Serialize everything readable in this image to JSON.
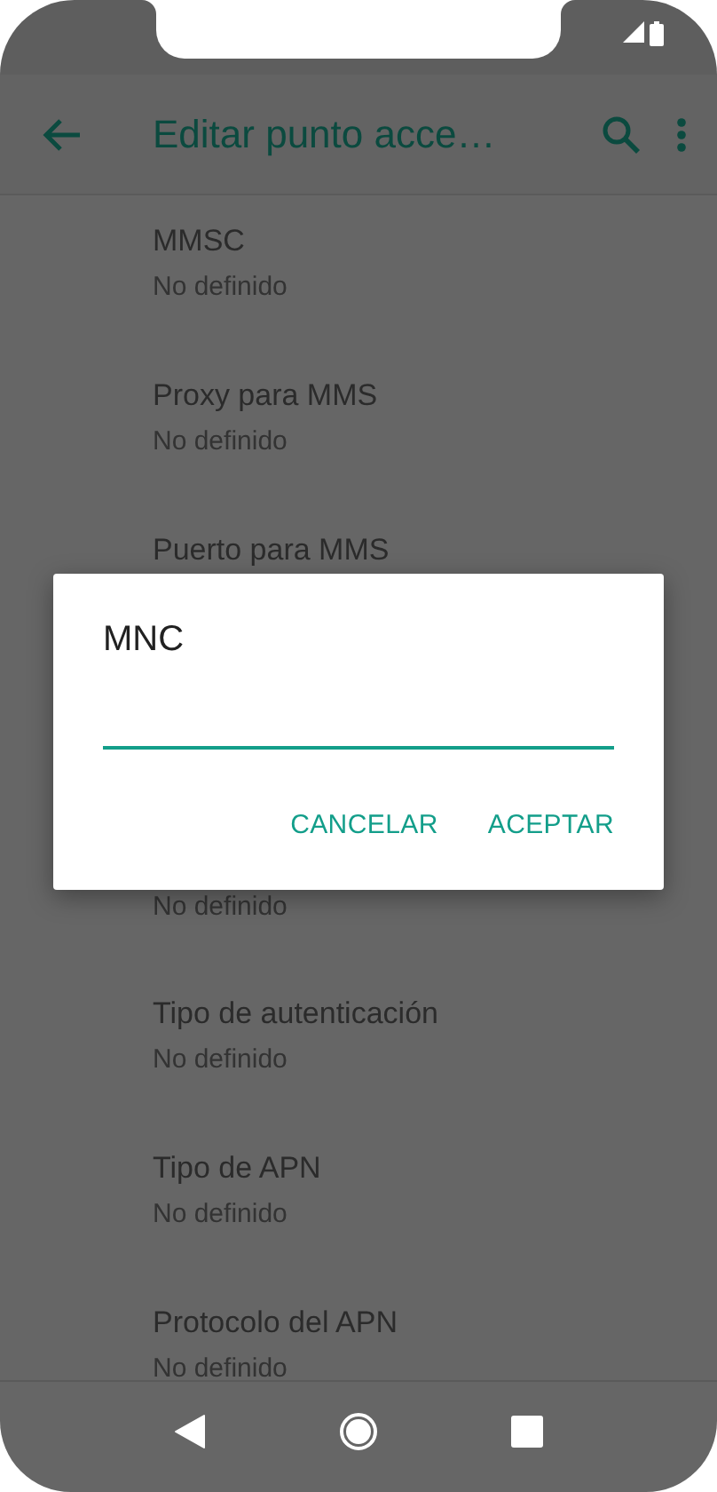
{
  "app_bar": {
    "title": "Editar punto acce…"
  },
  "settings": [
    {
      "title": "MMSC",
      "subtitle": "No definido"
    },
    {
      "title": "Proxy para MMS",
      "subtitle": "No definido"
    },
    {
      "title": "Puerto para MMS"
    },
    {
      "subtitle": "No definido"
    },
    {
      "title": "Tipo de autenticación",
      "subtitle": "No definido"
    },
    {
      "title": "Tipo de APN",
      "subtitle": "No definido"
    },
    {
      "title": "Protocolo del APN",
      "subtitle": "No definido"
    }
  ],
  "dialog": {
    "title": "MNC",
    "buttons": [
      "CANCELAR",
      "ACEPTAR"
    ]
  }
}
